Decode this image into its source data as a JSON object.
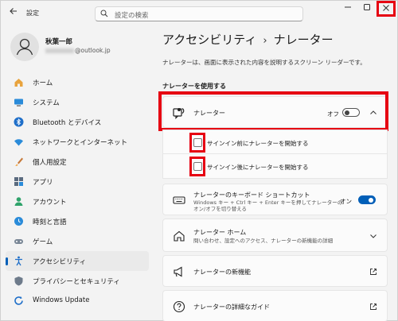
{
  "window": {
    "back_icon": "arrow-left-icon",
    "app_title": "設定",
    "min_icon": "minimize-icon",
    "max_icon": "maximize-icon",
    "close_icon": "close-icon"
  },
  "search": {
    "placeholder": "設定の検索",
    "icon": "search-icon"
  },
  "profile": {
    "name": "秋葉一郎",
    "email_visible": "@outlook.jp",
    "avatar_icon": "person-icon"
  },
  "sidebar": {
    "items": [
      {
        "label": "ホーム",
        "icon": "home-icon",
        "active": false
      },
      {
        "label": "システム",
        "icon": "monitor-icon",
        "active": false
      },
      {
        "label": "Bluetooth とデバイス",
        "icon": "bluetooth-icon",
        "active": false
      },
      {
        "label": "ネットワークとインターネット",
        "icon": "wifi-icon",
        "active": false
      },
      {
        "label": "個人用設定",
        "icon": "brush-icon",
        "active": false
      },
      {
        "label": "アプリ",
        "icon": "apps-icon",
        "active": false
      },
      {
        "label": "アカウント",
        "icon": "account-icon",
        "active": false
      },
      {
        "label": "時刻と言語",
        "icon": "globe-clock-icon",
        "active": false
      },
      {
        "label": "ゲーム",
        "icon": "gamepad-icon",
        "active": false
      },
      {
        "label": "アクセシビリティ",
        "icon": "accessibility-icon",
        "active": true
      },
      {
        "label": "プライバシーとセキュリティ",
        "icon": "shield-icon",
        "active": false
      },
      {
        "label": "Windows Update",
        "icon": "update-icon",
        "active": false
      }
    ]
  },
  "main": {
    "breadcrumb_parent": "アクセシビリティ",
    "breadcrumb_sep": "›",
    "breadcrumb_current": "ナレーター",
    "description": "ナレーターは、画面に表示された内容を説明するスクリーン リーダーです。",
    "section_title": "ナレーターを使用する",
    "narrator": {
      "title": "ナレーター",
      "toggle_label": "オフ",
      "toggle_on": false,
      "icon": "narrator-icon"
    },
    "options": [
      {
        "label": "サインイン前にナレーターを開始する",
        "checked": false
      },
      {
        "label": "サインイン後にナレーターを開始する",
        "checked": false
      }
    ],
    "keyboard_shortcut": {
      "title": "ナレーターのキーボード ショートカット",
      "sub1": "Windows キー + Ctrl キー + Enter キーを押してナレーターの",
      "sub2": "オン/オフを切り替える",
      "toggle_label": "オン",
      "toggle_on": true,
      "icon": "keyboard-icon"
    },
    "narrator_home": {
      "title": "ナレーター ホーム",
      "sub": "問い合わせ、設定へのアクセス、ナレーターの新機能の詳細",
      "icon": "home-icon"
    },
    "whats_new": {
      "title": "ナレーターの新機能",
      "icon": "megaphone-icon"
    },
    "guide": {
      "title": "ナレーターの詳細なガイド",
      "icon": "help-icon"
    }
  }
}
